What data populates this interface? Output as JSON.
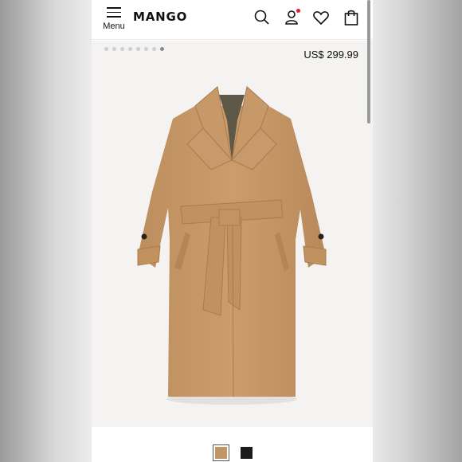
{
  "header": {
    "menu_label": "Menu",
    "logo": "MANGO",
    "icons": [
      "search-icon",
      "account-icon",
      "heart-icon",
      "shopping-bag-icon"
    ],
    "notification_color": "#e21c2a"
  },
  "gallery": {
    "image_count": 8,
    "active_image": 8,
    "price": "US$ 299.99"
  },
  "colors": {
    "options": [
      {
        "name": "camel-swatch",
        "hex": "#c29566",
        "selected": true
      },
      {
        "name": "black-swatch",
        "hex": "#1b1b1b",
        "selected": false
      }
    ]
  }
}
